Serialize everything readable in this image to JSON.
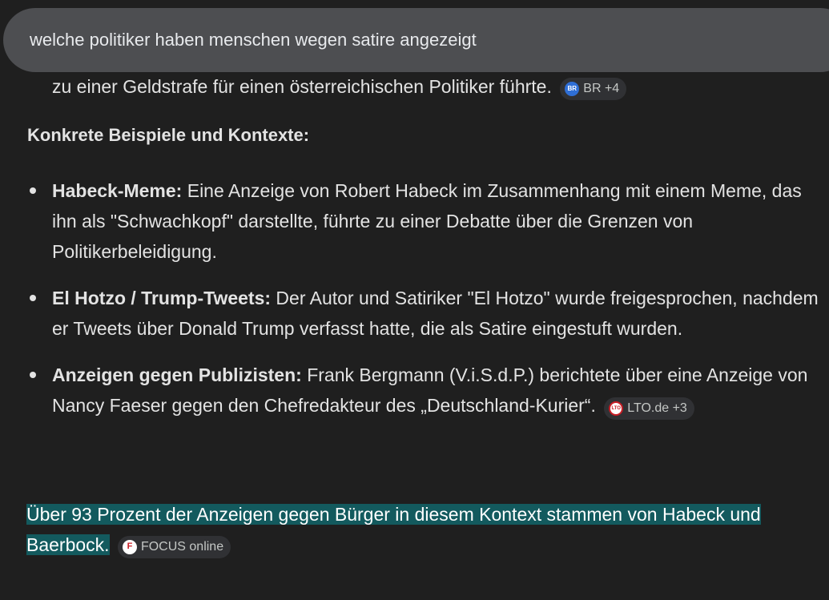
{
  "search": {
    "query": "welche politiker haben menschen wegen satire angezeigt"
  },
  "partial_line": {
    "text": "zu einer Geldstrafe für einen österreichischen Politiker führte.",
    "chip_label": "BR +4",
    "chip_icon_text": "BR"
  },
  "section": {
    "heading": "Konkrete Beispiele und Kontexte:"
  },
  "bullets": [
    {
      "title": "Habeck-Meme:",
      "text": " Eine Anzeige von Robert Habeck im Zusammenhang mit einem Meme, das ihn als \"Schwachkopf\" darstellte, führte zu einer Debatte über die Grenzen von Politikerbeleidigung."
    },
    {
      "title": "El Hotzo / Trump-Tweets:",
      "text": " Der Autor und Satiriker \"El Hotzo\" wurde freigesprochen, nachdem er Tweets über Donald Trump verfasst hatte, die als Satire eingestuft wurden."
    },
    {
      "title": "Anzeigen gegen Publizisten:",
      "text": " Frank Bergmann (V.i.S.d.P.) berichtete über eine Anzeige von Nancy Faeser gegen den Chefredakteur des „Deutschland-Kurier“.",
      "chip_label": "LTO.de +3",
      "chip_icon_text": "LTO"
    }
  ],
  "highlight": {
    "text": "Über 93 Prozent der Anzeigen gegen Bürger in diesem Kontext stammen von Habeck und Baerbock.",
    "chip_label": "FOCUS online",
    "chip_icon_text": "F"
  },
  "colors": {
    "background": "#1f1f1f",
    "search_bar": "#4d4e51",
    "chip_background": "#303134",
    "highlight": "#135a5e",
    "text": "#e3e3e3"
  }
}
